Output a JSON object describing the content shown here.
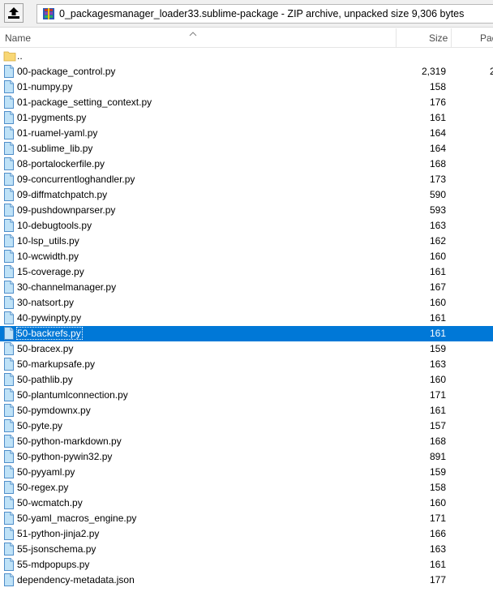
{
  "pathbar": {
    "address": "0_packagesmanager_loader33.sublime-package - ZIP archive, unpacked size 9,306 bytes"
  },
  "columns": {
    "name": "Name",
    "size": "Size",
    "packed": "Pac"
  },
  "colors": {
    "selection": "#0078d7",
    "folder": "#f8d775",
    "file": "#bfe2f7"
  },
  "files": [
    {
      "name": "..",
      "size": "",
      "packed": "",
      "icon": "folder-icon"
    },
    {
      "name": "00-package_control.py",
      "size": "2,319",
      "packed": "2",
      "icon": "file-icon"
    },
    {
      "name": "01-numpy.py",
      "size": "158",
      "packed": "",
      "icon": "file-icon"
    },
    {
      "name": "01-package_setting_context.py",
      "size": "176",
      "packed": "",
      "icon": "file-icon"
    },
    {
      "name": "01-pygments.py",
      "size": "161",
      "packed": "",
      "icon": "file-icon"
    },
    {
      "name": "01-ruamel-yaml.py",
      "size": "164",
      "packed": "",
      "icon": "file-icon"
    },
    {
      "name": "01-sublime_lib.py",
      "size": "164",
      "packed": "",
      "icon": "file-icon"
    },
    {
      "name": "08-portalockerfile.py",
      "size": "168",
      "packed": "",
      "icon": "file-icon"
    },
    {
      "name": "09-concurrentloghandler.py",
      "size": "173",
      "packed": "",
      "icon": "file-icon"
    },
    {
      "name": "09-diffmatchpatch.py",
      "size": "590",
      "packed": "",
      "icon": "file-icon"
    },
    {
      "name": "09-pushdownparser.py",
      "size": "593",
      "packed": "",
      "icon": "file-icon"
    },
    {
      "name": "10-debugtools.py",
      "size": "163",
      "packed": "",
      "icon": "file-icon"
    },
    {
      "name": "10-lsp_utils.py",
      "size": "162",
      "packed": "",
      "icon": "file-icon"
    },
    {
      "name": "10-wcwidth.py",
      "size": "160",
      "packed": "",
      "icon": "file-icon"
    },
    {
      "name": "15-coverage.py",
      "size": "161",
      "packed": "",
      "icon": "file-icon"
    },
    {
      "name": "30-channelmanager.py",
      "size": "167",
      "packed": "",
      "icon": "file-icon"
    },
    {
      "name": "30-natsort.py",
      "size": "160",
      "packed": "",
      "icon": "file-icon"
    },
    {
      "name": "40-pywinpty.py",
      "size": "161",
      "packed": "",
      "icon": "file-icon"
    },
    {
      "name": "50-backrefs.py",
      "size": "161",
      "packed": "",
      "icon": "file-icon",
      "selected": true
    },
    {
      "name": "50-bracex.py",
      "size": "159",
      "packed": "",
      "icon": "file-icon"
    },
    {
      "name": "50-markupsafe.py",
      "size": "163",
      "packed": "",
      "icon": "file-icon"
    },
    {
      "name": "50-pathlib.py",
      "size": "160",
      "packed": "",
      "icon": "file-icon"
    },
    {
      "name": "50-plantumlconnection.py",
      "size": "171",
      "packed": "",
      "icon": "file-icon"
    },
    {
      "name": "50-pymdownx.py",
      "size": "161",
      "packed": "",
      "icon": "file-icon"
    },
    {
      "name": "50-pyte.py",
      "size": "157",
      "packed": "",
      "icon": "file-icon"
    },
    {
      "name": "50-python-markdown.py",
      "size": "168",
      "packed": "",
      "icon": "file-icon"
    },
    {
      "name": "50-python-pywin32.py",
      "size": "891",
      "packed": "",
      "icon": "file-icon"
    },
    {
      "name": "50-pyyaml.py",
      "size": "159",
      "packed": "",
      "icon": "file-icon"
    },
    {
      "name": "50-regex.py",
      "size": "158",
      "packed": "",
      "icon": "file-icon"
    },
    {
      "name": "50-wcmatch.py",
      "size": "160",
      "packed": "",
      "icon": "file-icon"
    },
    {
      "name": "50-yaml_macros_engine.py",
      "size": "171",
      "packed": "",
      "icon": "file-icon"
    },
    {
      "name": "51-python-jinja2.py",
      "size": "166",
      "packed": "",
      "icon": "file-icon"
    },
    {
      "name": "55-jsonschema.py",
      "size": "163",
      "packed": "",
      "icon": "file-icon"
    },
    {
      "name": "55-mdpopups.py",
      "size": "161",
      "packed": "",
      "icon": "file-icon"
    },
    {
      "name": "dependency-metadata.json",
      "size": "177",
      "packed": "",
      "icon": "file-icon"
    }
  ]
}
